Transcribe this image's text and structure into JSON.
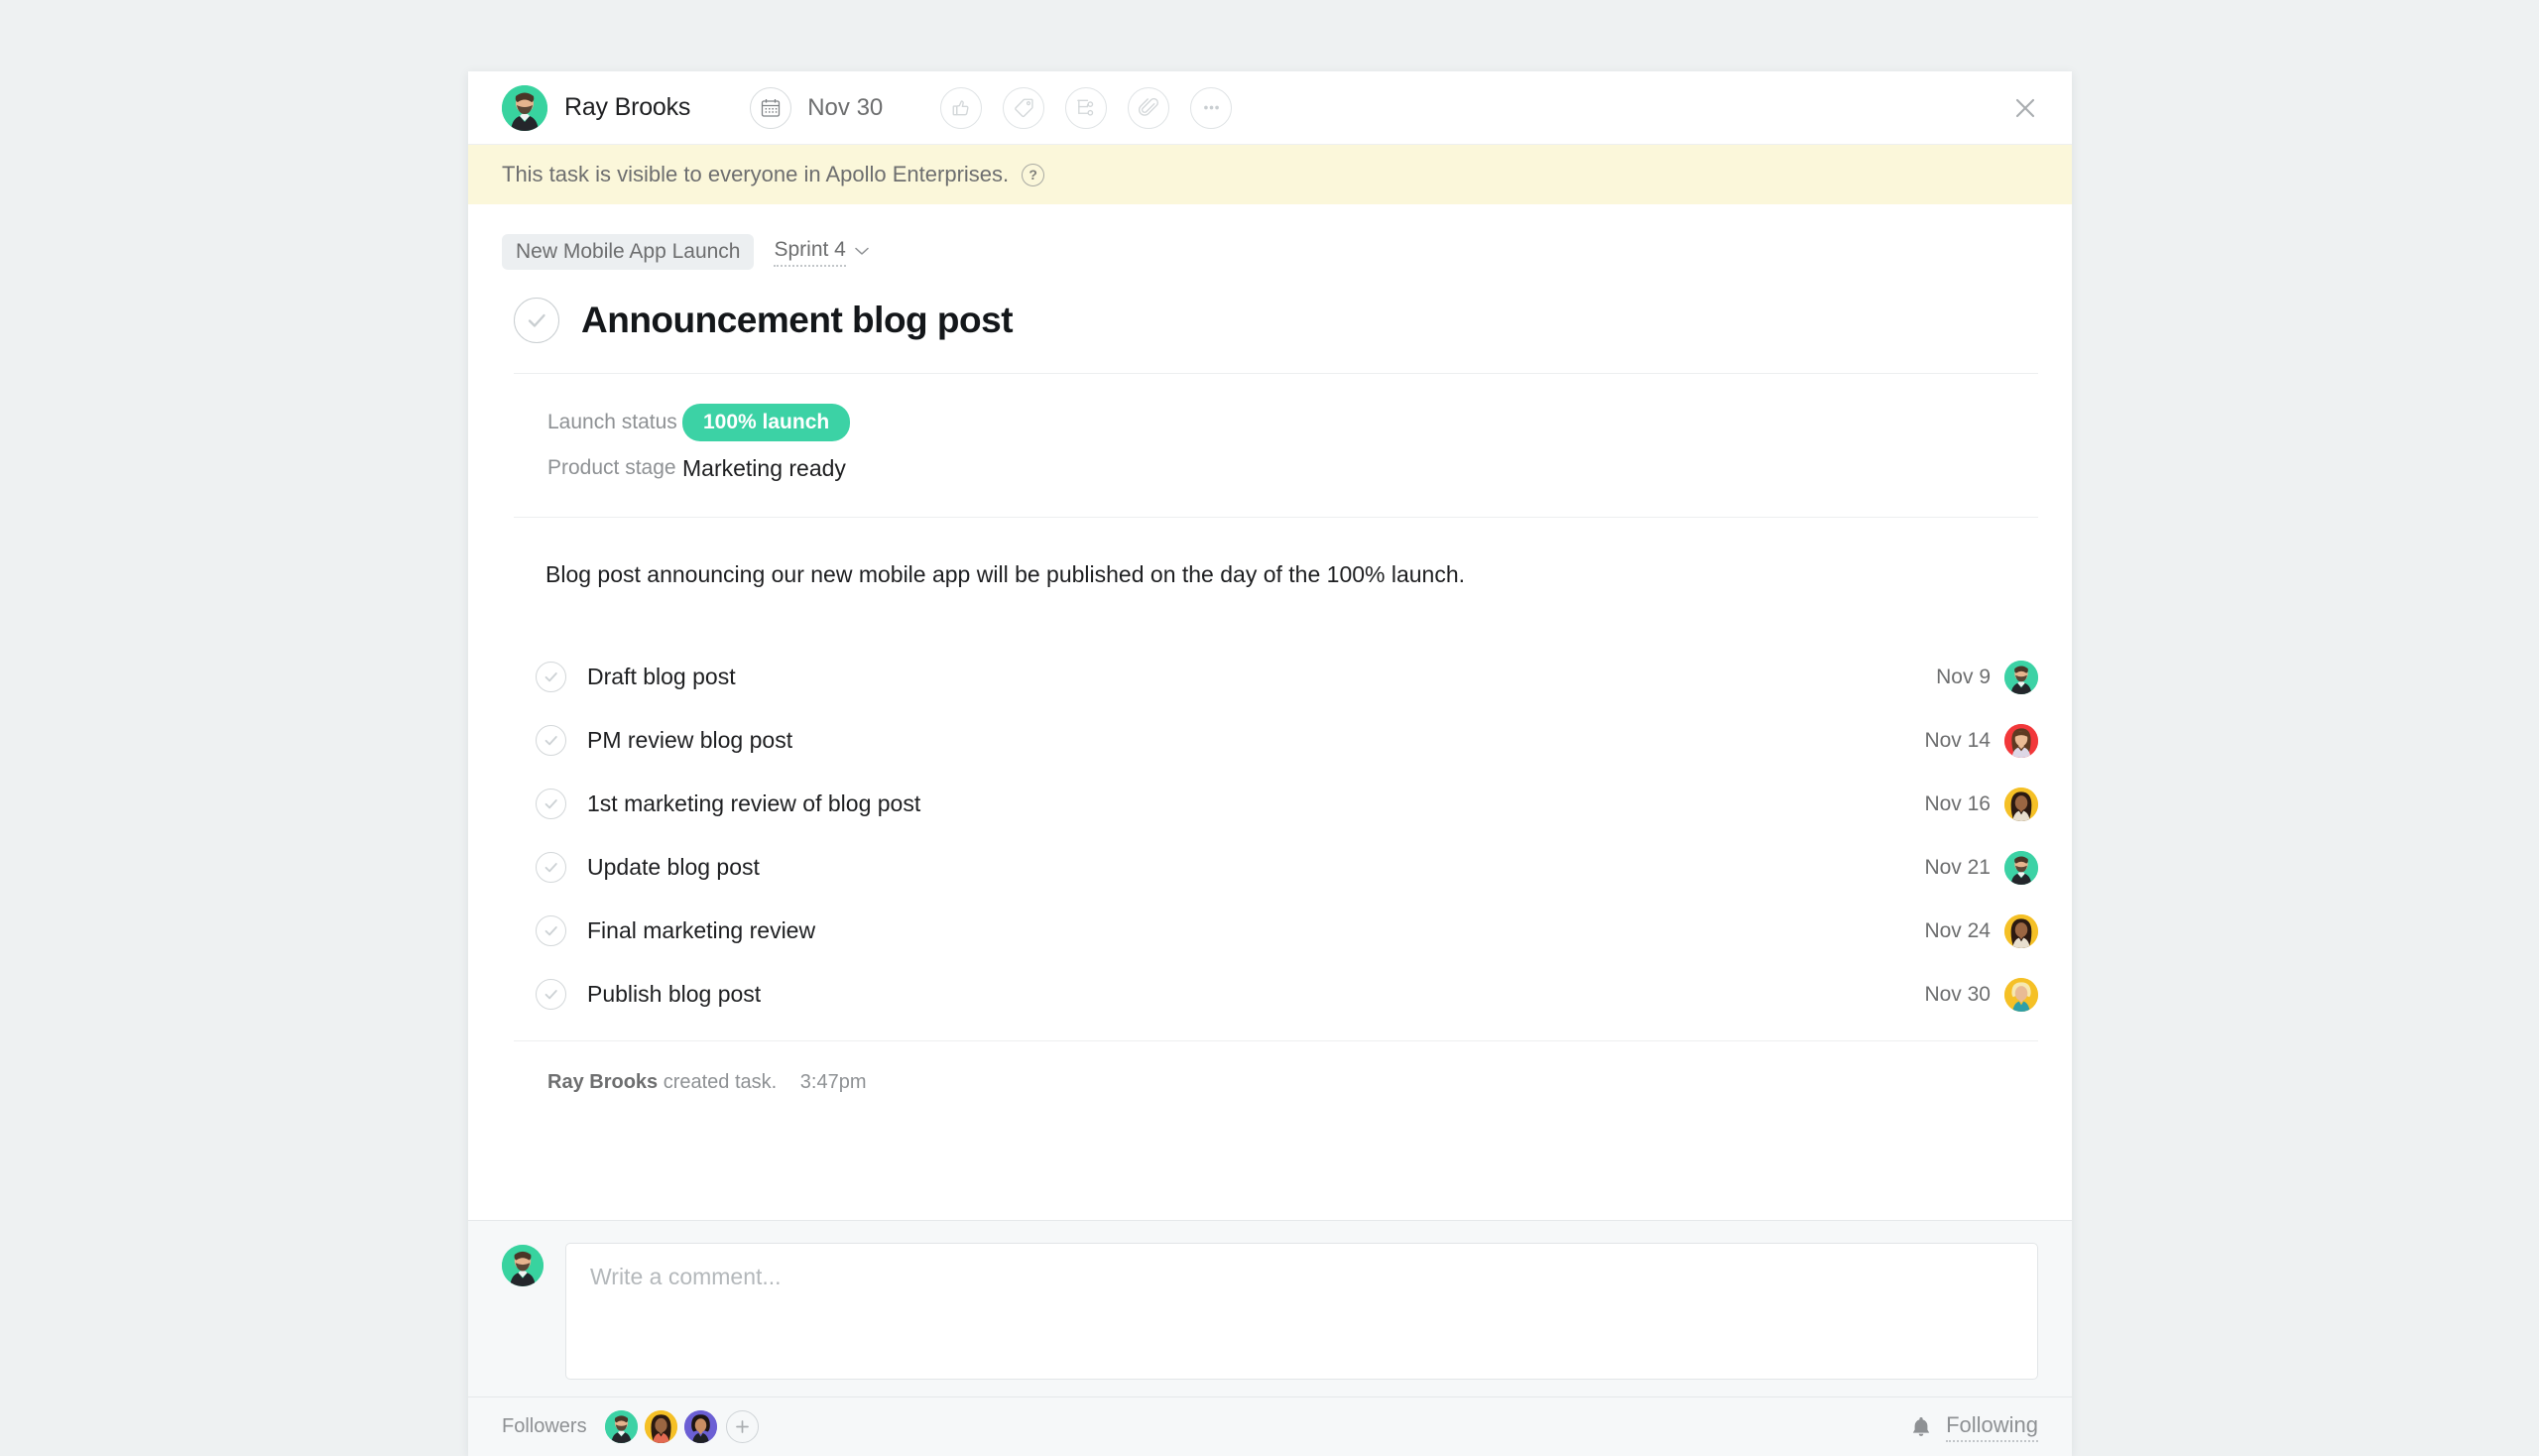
{
  "header": {
    "assignee": "Ray Brooks",
    "assignee_avatar_color": "#38d39f",
    "due_date": "Nov 30",
    "calendar_icon": "calendar-icon",
    "actions": [
      {
        "name": "like-button",
        "icon": "thumbs-up-icon"
      },
      {
        "name": "tag-button",
        "icon": "tag-icon"
      },
      {
        "name": "subtask-button",
        "icon": "branch-icon"
      },
      {
        "name": "attachment-button",
        "icon": "paperclip-icon"
      },
      {
        "name": "more-button",
        "icon": "ellipsis-icon"
      }
    ],
    "close_icon": "close-icon"
  },
  "banner": {
    "text": "This task is visible to everyone in Apollo Enterprises.",
    "help_icon": "question-mark-icon",
    "background": "#fbf7da"
  },
  "breadcrumb": {
    "project": "New Mobile App Launch",
    "section": "Sprint 4",
    "caret_icon": "chevron-down-icon"
  },
  "task": {
    "title": "Announcement blog post",
    "complete_icon": "check-icon",
    "description": "Blog post announcing our new mobile app will be published on the day of the 100% launch."
  },
  "custom_fields": [
    {
      "label": "Launch status",
      "value": "100% launch",
      "style": "pill",
      "color": "#3cd2a5"
    },
    {
      "label": "Product stage",
      "value": "Marketing ready",
      "style": "text"
    }
  ],
  "subtasks": [
    {
      "name": "Draft blog post",
      "date": "Nov 9",
      "avatar_color": "#3cd2a5",
      "avatar_type": "man-beard"
    },
    {
      "name": "PM review blog post",
      "date": "Nov 14",
      "avatar_color": "#f2383a",
      "avatar_type": "woman-bangs"
    },
    {
      "name": "1st marketing review of blog post",
      "date": "Nov 16",
      "avatar_color": "#f5c026",
      "avatar_type": "woman-dark"
    },
    {
      "name": "Update blog post",
      "date": "Nov 21",
      "avatar_color": "#3cd2a5",
      "avatar_type": "man-beard"
    },
    {
      "name": "Final marketing review",
      "date": "Nov 24",
      "avatar_color": "#f5c026",
      "avatar_type": "woman-dark"
    },
    {
      "name": "Publish blog post",
      "date": "Nov 30",
      "avatar_color": "#f5c026",
      "avatar_type": "woman-blonde"
    }
  ],
  "activity": {
    "actor": "Ray Brooks",
    "action": "created task.",
    "time": "3:47pm"
  },
  "comment": {
    "placeholder": "Write a comment...",
    "avatar_color": "#38d39f"
  },
  "footer": {
    "followers_label": "Followers",
    "followers": [
      {
        "avatar_color": "#3cd2a5",
        "avatar_type": "man-beard"
      },
      {
        "avatar_color": "#f5c026",
        "avatar_type": "woman-dark"
      },
      {
        "avatar_color": "#6b5fd4",
        "avatar_type": "woman-short"
      }
    ],
    "add_follower_icon": "plus-icon",
    "following_label": "Following",
    "bell_icon": "bell-icon"
  }
}
